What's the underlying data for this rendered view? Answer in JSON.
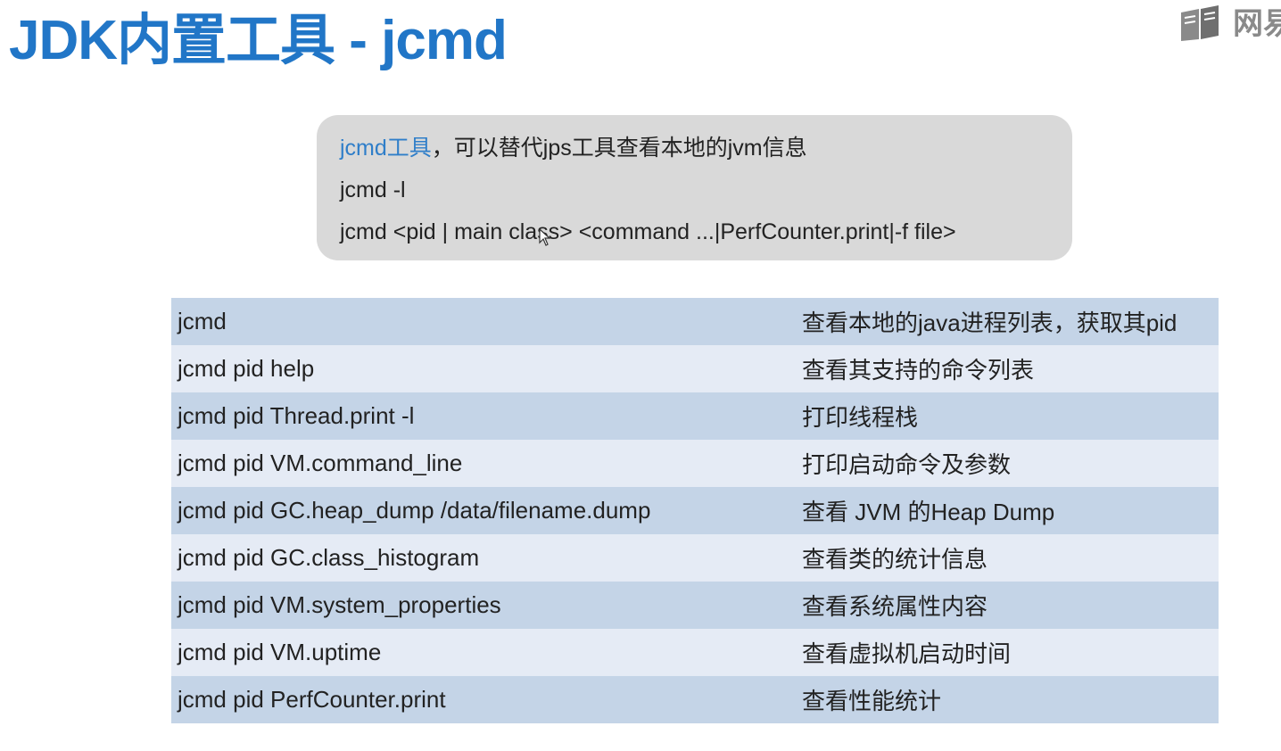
{
  "slide": {
    "title": "JDK内置工具 - jcmd",
    "logo_text": "网易"
  },
  "info_box": {
    "line1_accent": "jcmd工具",
    "line1_rest": "，可以替代jps工具查看本地的jvm信息",
    "line2": "jcmd -l",
    "line3": "jcmd <pid | main class> <command ...|PerfCounter.print|-f file>"
  },
  "commands": [
    {
      "cmd": "jcmd",
      "desc": "查看本地的java进程列表，获取其pid"
    },
    {
      "cmd": "jcmd pid help",
      "desc": "查看其支持的命令列表"
    },
    {
      "cmd": "jcmd pid Thread.print -l",
      "desc": "打印线程栈"
    },
    {
      "cmd": " jcmd pid VM.command_line",
      "desc": "打印启动命令及参数"
    },
    {
      "cmd": " jcmd pid GC.heap_dump /data/filename.dump",
      "desc": "查看 JVM 的Heap Dump"
    },
    {
      "cmd": "jcmd pid GC.class_histogram",
      "desc": "查看类的统计信息"
    },
    {
      "cmd": " jcmd pid VM.system_properties",
      "desc": "查看系统属性内容"
    },
    {
      "cmd": " jcmd pid VM.uptime",
      "desc": "查看虚拟机启动时间"
    },
    {
      "cmd": "jcmd pid PerfCounter.print",
      "desc": "查看性能统计"
    }
  ],
  "colors": {
    "title": "#2176c7",
    "accent": "#2f7ec9",
    "box_bg": "#d9d9d9",
    "row_dark": "#c4d4e7",
    "row_light": "#e5ebf5"
  },
  "icons": {
    "logo": "book-logo-icon",
    "cursor": "mouse-pointer-icon"
  }
}
